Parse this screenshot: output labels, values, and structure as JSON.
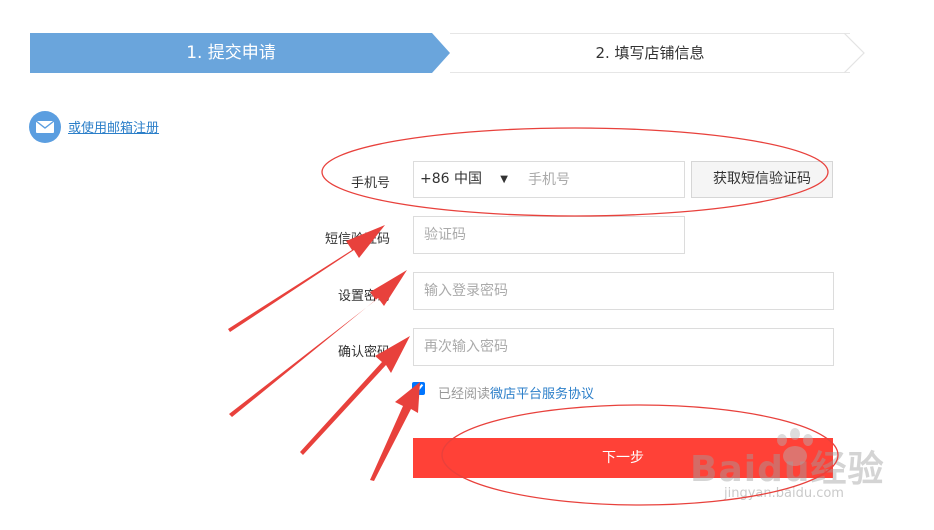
{
  "steps": {
    "step1": "1. 提交申请",
    "step2": "2. 填写店铺信息"
  },
  "email_link": "或使用邮箱注册",
  "form": {
    "phone_label": "手机号",
    "country_code": "+86 中国",
    "phone_placeholder": "手机号",
    "sms_button": "获取短信验证码",
    "code_label": "短信验证码",
    "code_placeholder": "验证码",
    "password_label": "设置密码",
    "password_placeholder": "输入登录密码",
    "confirm_label": "确认密码",
    "confirm_placeholder": "再次输入密码",
    "agree_prefix": "已经阅读",
    "agree_link": "微店平台服务协议",
    "agree_checked": true,
    "next_button": "下一步"
  },
  "watermark": {
    "brand": "Baidu经验",
    "url": "jingyan.baidu.com"
  },
  "colors": {
    "step_active": "#6aa5dc",
    "primary_button": "#ff4137",
    "link": "#2c7fc9",
    "annotation": "#e8413c"
  }
}
